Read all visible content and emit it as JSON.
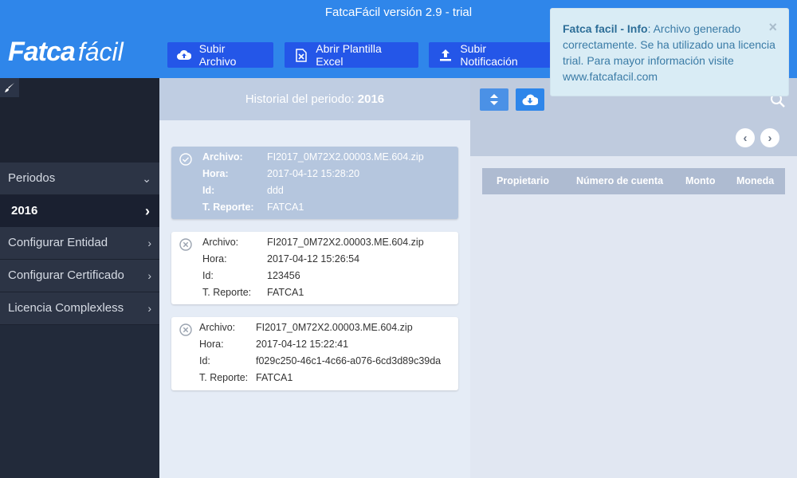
{
  "window": {
    "title": "FatcaFácil versión 2.9 - trial"
  },
  "logo": {
    "bold": "Fatca",
    "light": "fácil"
  },
  "toolbar": {
    "upload_file": "Subir Archivo",
    "open_excel_template": "Abrir Plantilla Excel",
    "upload_notification": "Subir Notificación"
  },
  "sidebar": {
    "items": [
      {
        "label": "Periodos"
      },
      {
        "label": "2016"
      },
      {
        "label": "Configurar Entidad"
      },
      {
        "label": "Configurar Certificado"
      },
      {
        "label": "Licencia Complexless"
      }
    ]
  },
  "history": {
    "prefix": "Historial del periodo:",
    "period": "2016",
    "labels": {
      "file": "Archivo:",
      "time": "Hora:",
      "id": "Id:",
      "report": "T. Reporte:"
    },
    "entries": [
      {
        "status": "success",
        "file": "FI2017_0M72X2.00003.ME.604.zip",
        "time": "2017-04-12 15:28:20",
        "id": "ddd",
        "report": "FATCA1"
      },
      {
        "status": "error",
        "file": "FI2017_0M72X2.00003.ME.604.zip",
        "time": "2017-04-12 15:26:54",
        "id": "123456",
        "report": "FATCA1"
      },
      {
        "status": "error",
        "file": "FI2017_0M72X2.00003.ME.604.zip",
        "time": "2017-04-12 15:22:41",
        "id": "f029c250-46c1-4c66-a076-6cd3d89c39da",
        "report": "FATCA1"
      }
    ]
  },
  "table": {
    "columns": [
      "Propietario",
      "Número de cuenta",
      "Monto",
      "Moneda"
    ]
  },
  "toast": {
    "title": "Fatca facil - Info",
    "message": ": Archivo generado correctamente. Se ha utilizado una licencia trial. Para mayor información visite www.fatcafacil.com",
    "close": "×"
  },
  "colors": {
    "header": "#2f86ea",
    "button": "#2456e8",
    "sidebar": "#222a3a"
  },
  "icons": [
    "cloud-upload-icon",
    "excel-icon",
    "upload-icon",
    "brush-icon",
    "chevron-down-icon",
    "chevron-right-icon",
    "check-circle-icon",
    "x-circle-icon",
    "sort-icon",
    "cloud-download-icon",
    "search-icon",
    "chevron-left-icon"
  ]
}
